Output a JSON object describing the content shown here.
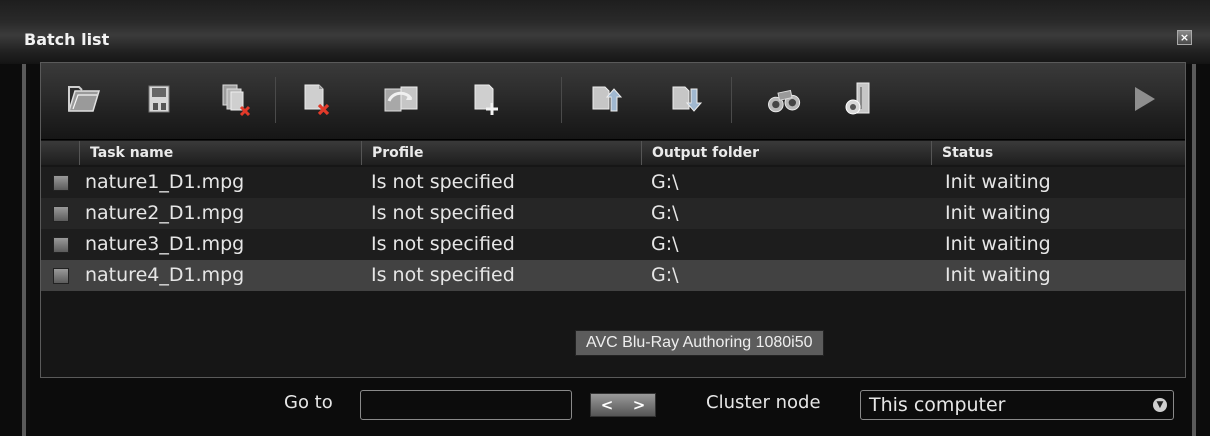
{
  "window": {
    "title": "Batch list",
    "close_glyph": "×"
  },
  "toolbar": {
    "buttons": [
      {
        "icon": "open-folder-icon"
      },
      {
        "icon": "save-icon"
      },
      {
        "icon": "remove-all-icon"
      },
      {
        "icon": "delete-task-icon"
      },
      {
        "icon": "convert-icon"
      },
      {
        "icon": "add-task-icon"
      },
      {
        "icon": "move-up-icon"
      },
      {
        "icon": "move-down-icon"
      },
      {
        "icon": "binoculars-icon"
      },
      {
        "icon": "settings-icon"
      },
      {
        "icon": "play-icon"
      }
    ]
  },
  "grid": {
    "columns": [
      "Task name",
      "Profile",
      "Output folder",
      "Status"
    ],
    "rows": [
      {
        "task": "nature1_D1.mpg",
        "profile": "Is not specified",
        "output": "G:\\",
        "status": "Init waiting"
      },
      {
        "task": "nature2_D1.mpg",
        "profile": "Is not specified",
        "output": "G:\\",
        "status": "Init waiting"
      },
      {
        "task": "nature3_D1.mpg",
        "profile": "Is not specified",
        "output": "G:\\",
        "status": "Init waiting"
      },
      {
        "task": "nature4_D1.mpg",
        "profile": "Is not specified",
        "output": "G:\\",
        "status": "Init waiting"
      }
    ],
    "selected_row": 3
  },
  "tooltip": {
    "text": "AVC Blu-Ray Authoring 1080i50"
  },
  "bottom": {
    "goto_label": "Go to",
    "goto_value": "",
    "prev_glyph": "<",
    "next_glyph": ">",
    "cluster_label": "Cluster node",
    "cluster_value": "This computer",
    "dropdown_glyph": "▼"
  }
}
